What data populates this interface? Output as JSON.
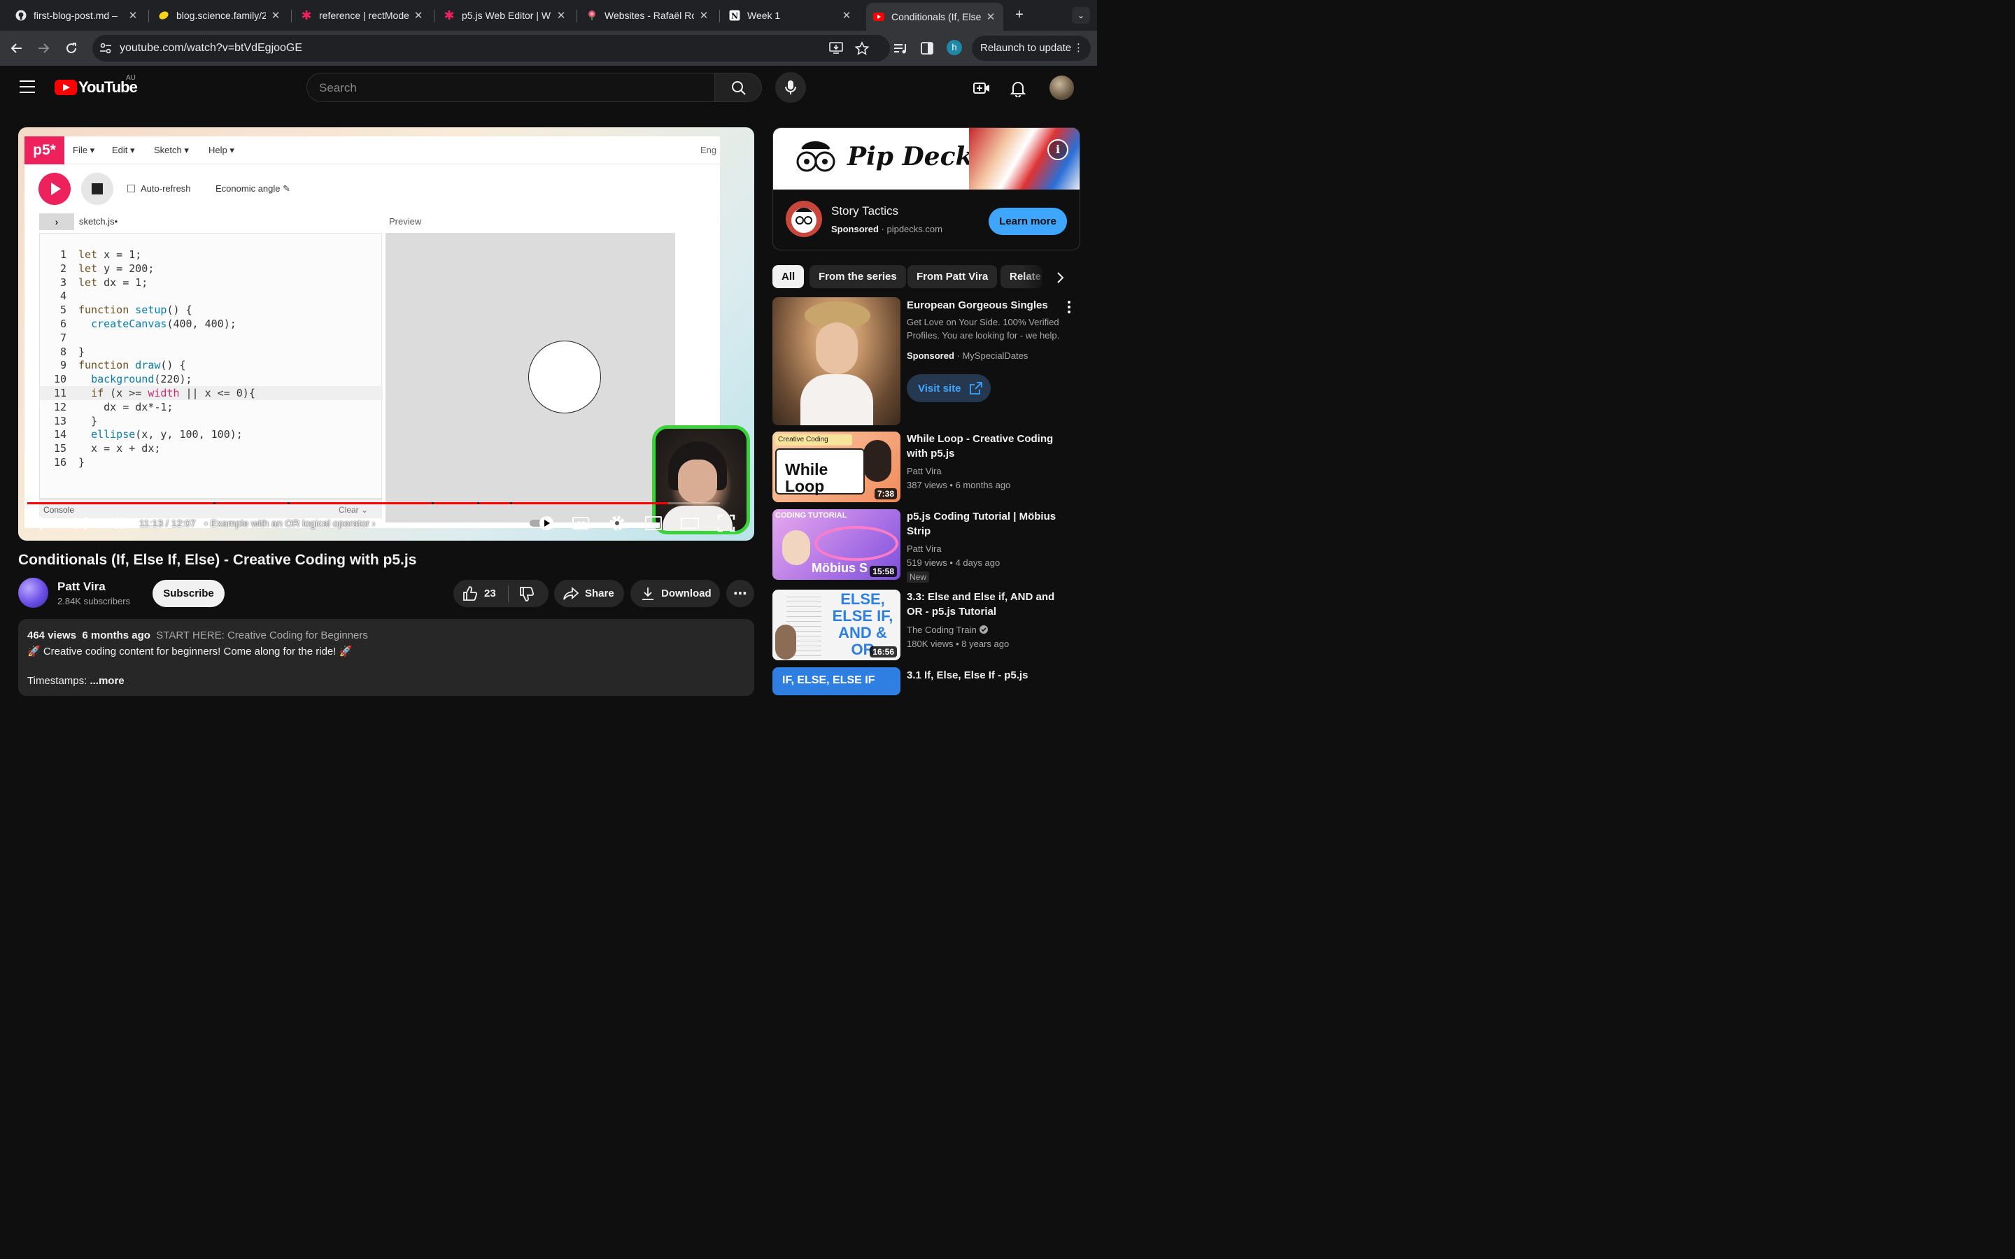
{
  "browser": {
    "tabs": [
      {
        "title": "first-blog-post.md –",
        "icon": "github-icon"
      },
      {
        "title": "blog.science.family/2",
        "icon": "lemon-icon"
      },
      {
        "title": "reference | rectMode",
        "icon": "p5-asterisk-icon"
      },
      {
        "title": "p5.js Web Editor | W",
        "icon": "p5-asterisk-icon"
      },
      {
        "title": "Websites - Rafaël Ro",
        "icon": "rose-icon"
      },
      {
        "title": "Week 1",
        "icon": "notion-icon"
      },
      {
        "title": "Conditionals (If, Else",
        "icon": "youtube-icon",
        "active": true
      }
    ],
    "url": "youtube.com/watch?v=btVdEgjooGE",
    "profile_initial": "h",
    "relaunch_label": "Relaunch to update"
  },
  "youtube": {
    "logo_text": "YouTube",
    "region": "AU",
    "search_placeholder": "Search"
  },
  "video": {
    "editor": {
      "logo": "p5*",
      "menus": [
        "File",
        "Edit",
        "Sketch",
        "Help"
      ],
      "language": "Eng",
      "auto_refresh_label": "Auto-refresh",
      "sketch_name": "Economic angle",
      "file_name": "sketch.js",
      "preview_label": "Preview",
      "console_label": "Console",
      "clear_label": "Clear",
      "code_lines": [
        {
          "n": "1",
          "text": "let x = 1;"
        },
        {
          "n": "2",
          "text": "let y = 200;"
        },
        {
          "n": "3",
          "text": "let dx = 1;"
        },
        {
          "n": "4",
          "text": ""
        },
        {
          "n": "5",
          "text": "function setup() {"
        },
        {
          "n": "6",
          "text": "  createCanvas(400, 400);"
        },
        {
          "n": "7",
          "text": ""
        },
        {
          "n": "8",
          "text": "}"
        },
        {
          "n": "9",
          "text": "function draw() {"
        },
        {
          "n": "10",
          "text": "  background(220);"
        },
        {
          "n": "11",
          "text": "  if (x >= width || x <= 0){"
        },
        {
          "n": "12",
          "text": "    dx = dx*-1;"
        },
        {
          "n": "13",
          "text": "  }"
        },
        {
          "n": "14",
          "text": "  ellipse(x, y, 100, 100);"
        },
        {
          "n": "15",
          "text": "  x = x + dx;"
        },
        {
          "n": "16",
          "text": "}"
        }
      ]
    },
    "time_display": "11:13 / 12:07",
    "chapter": "• Example with an OR logical operator",
    "progress_fraction": 0.925,
    "title": "Conditionals (If, Else If, Else) - Creative Coding with p5.js",
    "channel": {
      "name": "Patt Vira",
      "subscribers": "2.84K subscribers"
    },
    "subscribe_label": "Subscribe",
    "likes": "23",
    "share_label": "Share",
    "download_label": "Download",
    "description": {
      "views": "464 views",
      "age": "6 months ago",
      "playlist": "START HERE: Creative Coding for Beginners",
      "line2": "🚀 Creative coding content for beginners! Come along for the ride! 🚀",
      "line3": "Timestamps:",
      "more": "...more"
    }
  },
  "sidebar": {
    "ad": {
      "brand_banner": "Pip Decks",
      "title": "Story Tactics",
      "sponsored": "Sponsored",
      "domain": "pipdecks.com",
      "cta": "Learn more"
    },
    "chips": [
      "All",
      "From the series",
      "From Patt Vira",
      "Relate"
    ],
    "sponsored_video": {
      "title": "European Gorgeous Singles",
      "desc": "Get Love on Your Side. 100% Verified Profiles. You are looking for - we help.",
      "sponsored": "Sponsored",
      "advertiser": "MySpecialDates",
      "cta": "Visit site"
    },
    "videos": [
      {
        "title": "While Loop - Creative Coding with p5.js",
        "channel": "Patt Vira",
        "meta": "387 views • 6 months ago",
        "duration": "7:38",
        "thumb_text": "While Loop",
        "thumb_tag": "Creative Coding"
      },
      {
        "title": "p5.js Coding Tutorial | Möbius Strip",
        "channel": "Patt Vira",
        "meta": "519 views • 4 days ago",
        "duration": "15:58",
        "badge": "New",
        "thumb_text": "Möbius S",
        "thumb_tag": "CODING TUTORIAL"
      },
      {
        "title": "3.3: Else and Else if, AND and OR - p5.js Tutorial",
        "channel": "The Coding Train",
        "meta": "180K views • 8 years ago",
        "duration": "16:56",
        "thumb_text": "ELSE, ELSE IF, AND & OR"
      },
      {
        "title": "3.1 If, Else, Else If - p5.js",
        "thumb_text": "IF, ELSE, ELSE IF"
      }
    ]
  }
}
